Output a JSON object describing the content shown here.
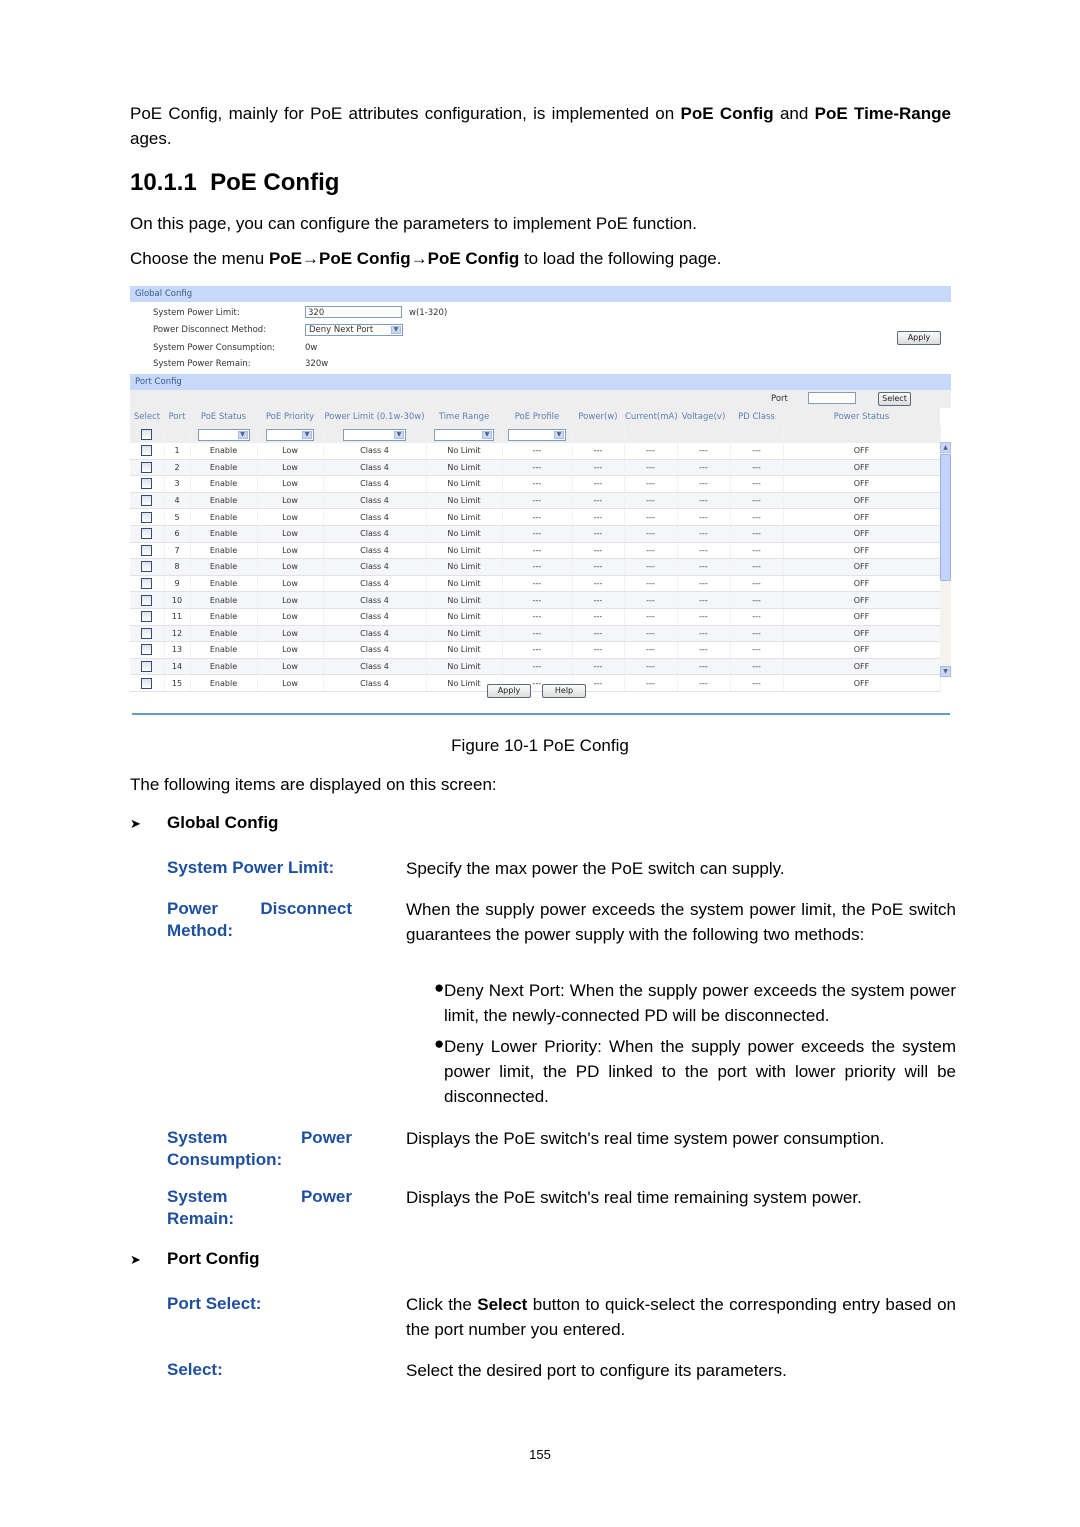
{
  "intro": {
    "p1": "PoE Config, mainly for PoE attributes configuration, is implemented on",
    "p1_b1": "PoE Config",
    "p1_and": "and",
    "p1_b2": "PoE Time-Range",
    "p1_end": "ages."
  },
  "section": {
    "number": "10.1.1",
    "title": "PoE Config"
  },
  "lead": "On this page, you can configure the parameters to implement PoE function.",
  "menu_path": {
    "prefix": "Choose the menu",
    "path": "PoE→PoE Config→PoE Config",
    "suffix": "to load the following page."
  },
  "figure": {
    "global_config": {
      "title": "Global Config",
      "system_power_limit_label": "System Power Limit:",
      "system_power_limit_value": "320",
      "system_power_limit_hint": "w(1-320)",
      "power_disconnect_method_label": "Power Disconnect Method:",
      "power_disconnect_method_value": "Deny Next Port",
      "system_power_consumption_label": "System Power Consumption:",
      "system_power_consumption_value": "0w",
      "system_power_remain_label": "System Power Remain:",
      "system_power_remain_value": "320w",
      "apply_label": "Apply"
    },
    "port_config": {
      "title": "Port Config",
      "port_label": "Port",
      "port_value": "",
      "select_button": "Select",
      "columns": [
        "Select",
        "Port",
        "PoE Status",
        "PoE Priority",
        "Power Limit (0.1w-30w)",
        "Time Range",
        "PoE Profile",
        "Power(w)",
        "Current(mA)",
        "Voltage(v)",
        "PD Class",
        "Power Status"
      ],
      "rows": [
        {
          "port": "1",
          "status": "Enable",
          "priority": "Low",
          "limit": "Class 4",
          "time_range": "No Limit",
          "profile": "---",
          "power": "---",
          "current": "---",
          "voltage": "---",
          "pd_class": "---",
          "power_status": "OFF"
        },
        {
          "port": "2",
          "status": "Enable",
          "priority": "Low",
          "limit": "Class 4",
          "time_range": "No Limit",
          "profile": "---",
          "power": "---",
          "current": "---",
          "voltage": "---",
          "pd_class": "---",
          "power_status": "OFF"
        },
        {
          "port": "3",
          "status": "Enable",
          "priority": "Low",
          "limit": "Class 4",
          "time_range": "No Limit",
          "profile": "---",
          "power": "---",
          "current": "---",
          "voltage": "---",
          "pd_class": "---",
          "power_status": "OFF"
        },
        {
          "port": "4",
          "status": "Enable",
          "priority": "Low",
          "limit": "Class 4",
          "time_range": "No Limit",
          "profile": "---",
          "power": "---",
          "current": "---",
          "voltage": "---",
          "pd_class": "---",
          "power_status": "OFF"
        },
        {
          "port": "5",
          "status": "Enable",
          "priority": "Low",
          "limit": "Class 4",
          "time_range": "No Limit",
          "profile": "---",
          "power": "---",
          "current": "---",
          "voltage": "---",
          "pd_class": "---",
          "power_status": "OFF"
        },
        {
          "port": "6",
          "status": "Enable",
          "priority": "Low",
          "limit": "Class 4",
          "time_range": "No Limit",
          "profile": "---",
          "power": "---",
          "current": "---",
          "voltage": "---",
          "pd_class": "---",
          "power_status": "OFF"
        },
        {
          "port": "7",
          "status": "Enable",
          "priority": "Low",
          "limit": "Class 4",
          "time_range": "No Limit",
          "profile": "---",
          "power": "---",
          "current": "---",
          "voltage": "---",
          "pd_class": "---",
          "power_status": "OFF"
        },
        {
          "port": "8",
          "status": "Enable",
          "priority": "Low",
          "limit": "Class 4",
          "time_range": "No Limit",
          "profile": "---",
          "power": "---",
          "current": "---",
          "voltage": "---",
          "pd_class": "---",
          "power_status": "OFF"
        },
        {
          "port": "9",
          "status": "Enable",
          "priority": "Low",
          "limit": "Class 4",
          "time_range": "No Limit",
          "profile": "---",
          "power": "---",
          "current": "---",
          "voltage": "---",
          "pd_class": "---",
          "power_status": "OFF"
        },
        {
          "port": "10",
          "status": "Enable",
          "priority": "Low",
          "limit": "Class 4",
          "time_range": "No Limit",
          "profile": "---",
          "power": "---",
          "current": "---",
          "voltage": "---",
          "pd_class": "---",
          "power_status": "OFF"
        },
        {
          "port": "11",
          "status": "Enable",
          "priority": "Low",
          "limit": "Class 4",
          "time_range": "No Limit",
          "profile": "---",
          "power": "---",
          "current": "---",
          "voltage": "---",
          "pd_class": "---",
          "power_status": "OFF"
        },
        {
          "port": "12",
          "status": "Enable",
          "priority": "Low",
          "limit": "Class 4",
          "time_range": "No Limit",
          "profile": "---",
          "power": "---",
          "current": "---",
          "voltage": "---",
          "pd_class": "---",
          "power_status": "OFF"
        },
        {
          "port": "13",
          "status": "Enable",
          "priority": "Low",
          "limit": "Class 4",
          "time_range": "No Limit",
          "profile": "---",
          "power": "---",
          "current": "---",
          "voltage": "---",
          "pd_class": "---",
          "power_status": "OFF"
        },
        {
          "port": "14",
          "status": "Enable",
          "priority": "Low",
          "limit": "Class 4",
          "time_range": "No Limit",
          "profile": "---",
          "power": "---",
          "current": "---",
          "voltage": "---",
          "pd_class": "---",
          "power_status": "OFF"
        },
        {
          "port": "15",
          "status": "Enable",
          "priority": "Low",
          "limit": "Class 4",
          "time_range": "No Limit",
          "profile": "---",
          "power": "---",
          "current": "---",
          "voltage": "---",
          "pd_class": "---",
          "power_status": "OFF"
        }
      ],
      "apply_label": "Apply",
      "help_label": "Help"
    },
    "caption": "Figure 10-1 PoE Config"
  },
  "items_intro": "The following items are displayed on this screen:",
  "global_config_section": {
    "title": "Global Config",
    "items": [
      {
        "term": "System Power Limit:",
        "def": "Specify the max power the PoE switch can supply."
      },
      {
        "term": "Power Disconnect Method:",
        "def": "When the supply power exceeds the system power limit, the PoE switch guarantees the power supply with the following two methods:",
        "bullets": [
          "Deny Next Port: When the supply power exceeds the system power limit, the newly-connected PD will be disconnected.",
          "Deny Lower Priority: When the supply power exceeds the system power limit, the PD linked to the port with lower priority will be disconnected."
        ]
      },
      {
        "term": "System Power Consumption:",
        "def": "Displays the PoE switch's real time system power consumption."
      },
      {
        "term": "System Power Remain:",
        "def": "Displays the PoE switch's real time remaining system power."
      }
    ]
  },
  "port_config_section": {
    "title": "Port Config",
    "items": [
      {
        "term": "Port Select:",
        "def_pre": "Click the",
        "def_bold": "Select",
        "def_post": "button to quick-select the corresponding entry based on the port number you entered."
      },
      {
        "term": "Select:",
        "def": "Select the desired port to configure its parameters."
      }
    ]
  },
  "page_number": "155",
  "colors": {
    "term_blue": "#1f4f9f",
    "section_bar": "#c6d9fb",
    "divider": "#5f9ec5"
  }
}
